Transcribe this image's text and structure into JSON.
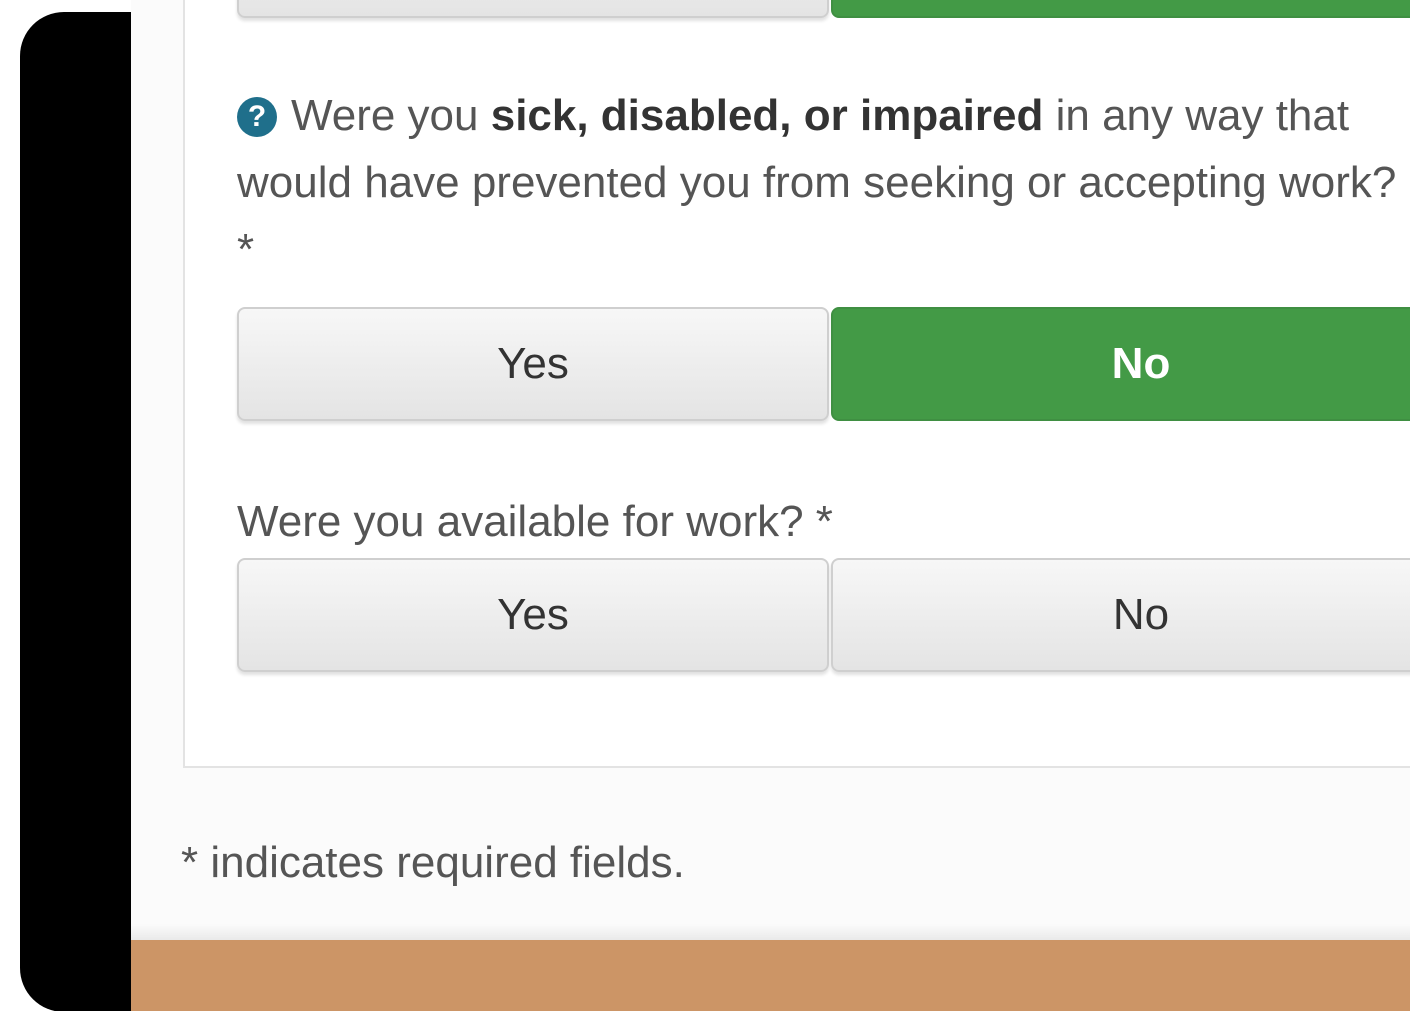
{
  "previous_question": {
    "yes_label": "",
    "no_label": "",
    "selected": "no"
  },
  "question_sick": {
    "text_before": "Were you ",
    "text_bold": "sick, disabled, or impaired",
    "text_after": " in any way that would have prevented you from seeking or accepting work? *",
    "help_icon": "question-circle-icon",
    "yes_label": "Yes",
    "no_label": "No",
    "selected": "no"
  },
  "question_available": {
    "text": "Were you available for work? *",
    "yes_label": "Yes",
    "no_label": "No",
    "selected": null
  },
  "required_note": "* indicates required fields.",
  "colors": {
    "selected_green": "#439a46",
    "help_icon_blue": "#1f6f8b",
    "footer_tan": "#cc9566"
  }
}
